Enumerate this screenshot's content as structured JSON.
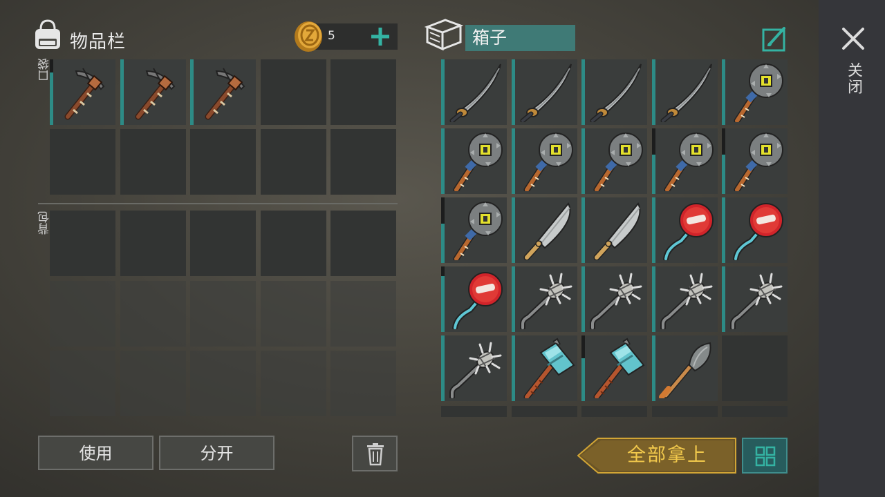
{
  "inventory": {
    "title": "物品栏",
    "pocket_label": "口袋",
    "backpack_label": "背包"
  },
  "currency": {
    "amount": "5"
  },
  "chest": {
    "title": "箱子"
  },
  "side": {
    "close_label": "关闭"
  },
  "buttons": {
    "use": "使用",
    "split": "分开",
    "take_all": "全部拿上"
  },
  "colors": {
    "accent_teal": "#2d8b86",
    "gold": "#f2c94c",
    "chest_title_bg": "#3f7a76"
  },
  "pocket_slots": [
    {
      "item": "pickaxe",
      "durability": 0.8
    },
    {
      "item": "pickaxe",
      "durability": 1.0
    },
    {
      "item": "pickaxe",
      "durability": 1.0
    },
    {
      "item": null
    },
    {
      "item": null
    },
    {
      "item": null
    },
    {
      "item": null
    },
    {
      "item": null
    },
    {
      "item": null
    },
    {
      "item": null
    }
  ],
  "backpack_slots": [
    {
      "item": null,
      "locked": false
    },
    {
      "item": null,
      "locked": false
    },
    {
      "item": null,
      "locked": false
    },
    {
      "item": null,
      "locked": false
    },
    {
      "item": null,
      "locked": false
    },
    {
      "item": null,
      "locked": true
    },
    {
      "item": null,
      "locked": true
    },
    {
      "item": null,
      "locked": true
    },
    {
      "item": null,
      "locked": true
    },
    {
      "item": null,
      "locked": true
    },
    {
      "item": null,
      "locked": true
    },
    {
      "item": null,
      "locked": true
    },
    {
      "item": null,
      "locked": true
    },
    {
      "item": null,
      "locked": true
    },
    {
      "item": null,
      "locked": true
    }
  ],
  "chest_slots": [
    {
      "item": "katana",
      "durability": 1.0
    },
    {
      "item": "katana",
      "durability": 1.0
    },
    {
      "item": "katana",
      "durability": 1.0
    },
    {
      "item": "katana",
      "durability": 1.0
    },
    {
      "item": "sawblade-mace",
      "durability": 1.0
    },
    {
      "item": "sawblade-mace",
      "durability": 1.0
    },
    {
      "item": "sawblade-mace",
      "durability": 1.0
    },
    {
      "item": "sawblade-mace",
      "durability": 1.0
    },
    {
      "item": "sawblade-mace",
      "durability": 0.6
    },
    {
      "item": "sawblade-mace",
      "durability": 0.6
    },
    {
      "item": "sawblade-mace",
      "durability": 0.6
    },
    {
      "item": "machete",
      "durability": 1.0
    },
    {
      "item": "machete",
      "durability": 1.0
    },
    {
      "item": "stop-sign-axe",
      "durability": 1.0
    },
    {
      "item": "stop-sign-axe",
      "durability": 1.0
    },
    {
      "item": "stop-sign-axe",
      "durability": 0.85
    },
    {
      "item": "spiked-pipe",
      "durability": 1.0
    },
    {
      "item": "spiked-pipe",
      "durability": 1.0
    },
    {
      "item": "spiked-pipe",
      "durability": 1.0
    },
    {
      "item": "spiked-pipe",
      "durability": 1.0
    },
    {
      "item": "spiked-pipe",
      "durability": 1.0
    },
    {
      "item": "sledgehammer",
      "durability": 1.0
    },
    {
      "item": "sledgehammer",
      "durability": 0.65
    },
    {
      "item": "shovel",
      "durability": 1.0
    },
    {
      "item": null
    }
  ]
}
